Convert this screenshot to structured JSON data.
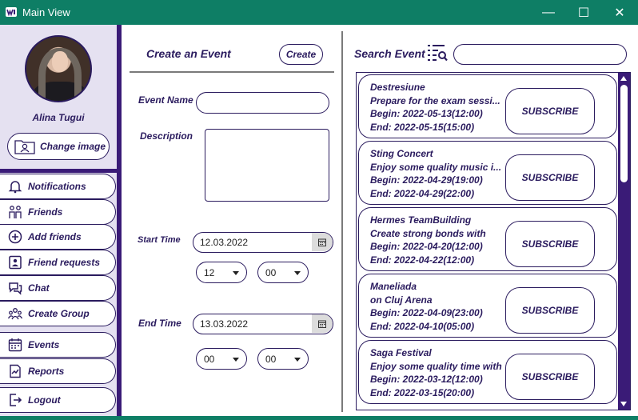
{
  "window": {
    "title": "Main View",
    "minimize": "—",
    "maximize": "☐",
    "close": "✕"
  },
  "sidebar": {
    "user_name": "Alina Tugui",
    "change_image_label": "Change image",
    "items": [
      {
        "label": "Notifications",
        "icon": "bell-icon"
      },
      {
        "label": "Friends",
        "icon": "friends-icon"
      },
      {
        "label": "Add friends",
        "icon": "plus-circle-icon"
      },
      {
        "label": "Friend requests",
        "icon": "request-icon"
      },
      {
        "label": "Chat",
        "icon": "chat-icon"
      },
      {
        "label": "Create Group",
        "icon": "group-icon"
      },
      {
        "label": "Events",
        "icon": "calendar-icon"
      },
      {
        "label": "Reports",
        "icon": "report-icon"
      },
      {
        "label": "Logout",
        "icon": "logout-icon"
      }
    ]
  },
  "create": {
    "title": "Create an Event",
    "create_button": "Create",
    "event_name_label": "Event Name",
    "event_name_value": "",
    "description_label": "Description",
    "description_value": "",
    "start_time_label": "Start Time",
    "start_date": "12.03.2022",
    "start_hour": "12",
    "start_minute": "00",
    "end_time_label": "End Time",
    "end_date": "13.03.2022",
    "end_hour": "00",
    "end_minute": "00"
  },
  "search": {
    "title": "Search Event",
    "query": "",
    "subscribe_label": "SUBSCRIBE",
    "events": [
      {
        "name": "Destresiune",
        "description": "Prepare for the exam sessi...",
        "begin": "Begin: 2022-05-13(12:00)",
        "end": "End: 2022-05-15(15:00)"
      },
      {
        "name": "Sting Concert",
        "description": "Enjoy some quality music i...",
        "begin": "Begin: 2022-04-29(19:00)",
        "end": "End: 2022-04-29(22:00)"
      },
      {
        "name": "Hermes TeamBuilding",
        "description": "Create strong bonds with",
        "begin": "Begin: 2022-04-20(12:00)",
        "end": "End: 2022-04-22(12:00)"
      },
      {
        "name": "Maneliada",
        "description": "on Cluj Arena",
        "begin": "Begin: 2022-04-09(23:00)",
        "end": "End: 2022-04-10(05:00)"
      },
      {
        "name": "Saga Festival",
        "description": "Enjoy some quality time with",
        "begin": "Begin: 2022-03-12(12:00)",
        "end": "End: 2022-03-15(20:00)"
      }
    ]
  },
  "colors": {
    "accent": "#3a1b77",
    "titlebar": "#0e7e65",
    "sidebar_bg": "#e5e1f1",
    "text": "#2a1b5e"
  }
}
